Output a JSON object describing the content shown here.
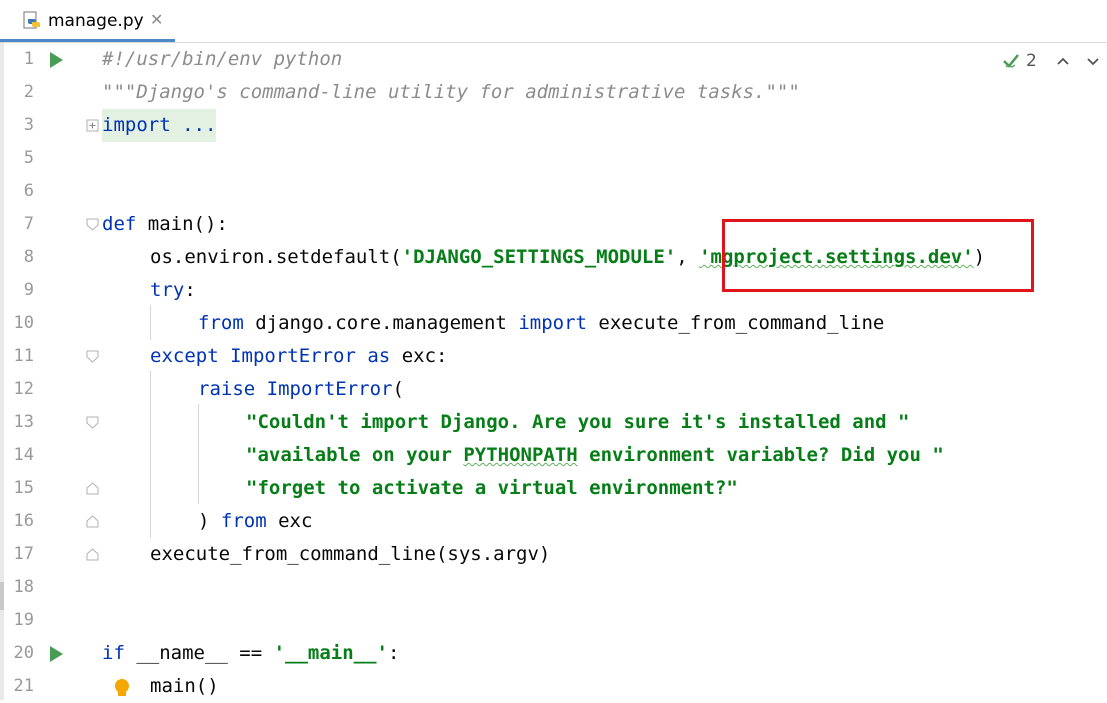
{
  "tab": {
    "file_name": "manage.py",
    "close_glyph": "✕"
  },
  "inspections": {
    "count": "2",
    "check_icon": "check-icon",
    "up": "⌃",
    "down": "⌄"
  },
  "lines": [
    {
      "num": "1"
    },
    {
      "num": "2"
    },
    {
      "num": "3"
    },
    {
      "num": "5"
    },
    {
      "num": "6"
    },
    {
      "num": "7"
    },
    {
      "num": "8"
    },
    {
      "num": "9"
    },
    {
      "num": "10"
    },
    {
      "num": "11"
    },
    {
      "num": "12"
    },
    {
      "num": "13"
    },
    {
      "num": "14"
    },
    {
      "num": "15"
    },
    {
      "num": "16"
    },
    {
      "num": "17"
    },
    {
      "num": "18"
    },
    {
      "num": "19"
    },
    {
      "num": "20"
    },
    {
      "num": "21"
    }
  ],
  "code": {
    "l1": "#!/usr/bin/env python",
    "l2": "\"\"\"Django's command-line utility for administrative tasks.\"\"\"",
    "l3": "import ...",
    "l7_kw": "def",
    "l7_rest": " main():",
    "l8_a": "os.environ.setdefault(",
    "l8_s1": "'DJANGO_SETTINGS_MODULE'",
    "l8_b": ", ",
    "l8_s2": "'mgproject.settings.dev'",
    "l8_c": ")",
    "l9_kw": "try",
    "l9_rest": ":",
    "l10_kw1": "from",
    "l10_mid": " django.core.management ",
    "l10_kw2": "import",
    "l10_rest": " execute_from_command_line",
    "l11_kw1": "except",
    "l11_cls": " ImportError ",
    "l11_kw2": "as",
    "l11_rest": " exc:",
    "l12_kw": "raise",
    "l12_cls": " ImportError",
    "l12_rest": "(",
    "l13": "\"Couldn't import Django. Are you sure it's installed and \"",
    "l14_a": "\"available on your ",
    "l14_u": "PYTHONPATH",
    "l14_b": " environment variable? Did you \"",
    "l15": "\"forget to activate a virtual environment?\"",
    "l16_a": ") ",
    "l16_kw": "from",
    "l16_rest": " exc",
    "l17": "execute_from_command_line(sys.argv)",
    "l20_kw": "if",
    "l20_mid": " __name__ == ",
    "l20_str": "'__main__'",
    "l20_rest": ":",
    "l21": "main()"
  }
}
